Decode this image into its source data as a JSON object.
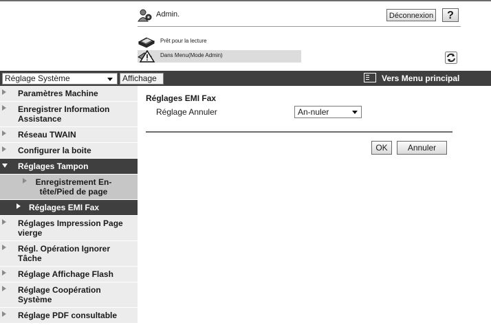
{
  "header": {
    "user_label": "Admin.",
    "logout_label": "Déconnexion",
    "help_label": "?"
  },
  "status": {
    "ready_text": "Prêt pour la lecture",
    "mode_text": "Dans Menu(Mode Admin)"
  },
  "navbar": {
    "system_select_value": "Réglage Système",
    "display_label": "Affichage",
    "main_menu_label": "Vers Menu principal"
  },
  "sidebar": {
    "items": [
      {
        "label": "Paramètres Machine"
      },
      {
        "label": "Enregistrer Information Assistance"
      },
      {
        "label": "Réseau TWAIN"
      },
      {
        "label": "Configurer la boite"
      },
      {
        "label": "Réglages Tampon"
      },
      {
        "label": "Enregistrement En-tête/Pied de page"
      },
      {
        "label": "Réglages EMI Fax"
      },
      {
        "label": "Réglages Impression Page vierge"
      },
      {
        "label": "Régl. Opération Ignorer Tâche"
      },
      {
        "label": "Réglage Affichage Flash"
      },
      {
        "label": "Réglage Coopération Système"
      },
      {
        "label": "Réglage PDF consultable"
      }
    ]
  },
  "main": {
    "title": "Réglages EMI Fax",
    "setting_label": "Réglage Annuler",
    "setting_value": "An-nuler",
    "ok_label": "OK",
    "cancel_label": "Annuler"
  },
  "colors": {
    "dark_bar": "#3f3f3f",
    "sidebar_item": "#ececec",
    "sidebar_subitem": "#c6c6c6",
    "status_bar": "#dcdcdc"
  }
}
